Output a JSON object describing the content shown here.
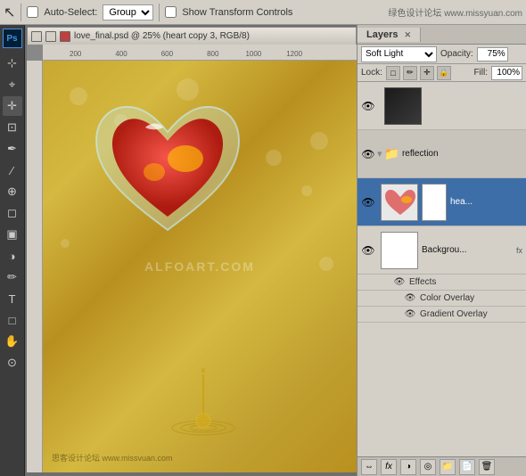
{
  "toolbar": {
    "arrow_tool": "↖",
    "auto_select_label": "Auto-Select:",
    "group_dropdown": "Group",
    "transform_label": "Show Transform Controls",
    "logo_text": "绿色设计论坛 www.missyuan.com"
  },
  "doc_window": {
    "title": "love_final.psd @ 25% (heart copy 3, RGB/8)",
    "ruler_marks_h": [
      "200",
      "400",
      "600",
      "800",
      "1000",
      "1200"
    ],
    "ruler_marks_v": [
      "",
      "",
      "",
      "",
      "",
      "",
      ""
    ],
    "watermark": "ALFOART.COM",
    "watermark2": "思客设计论坛 www.missvuan.com",
    "footer_text": ""
  },
  "layers_panel": {
    "tab_label": "Layers",
    "tab_close": "✕",
    "blend_mode": "Soft Light",
    "opacity_label": "Opacity:",
    "opacity_value": "75%",
    "lock_label": "Lock:",
    "lock_icons": [
      "□",
      "✏",
      "⊕",
      "🔒"
    ],
    "fill_label": "Fill:",
    "fill_value": "100%",
    "layers": [
      {
        "id": "layer-dark",
        "visible": true,
        "name": "",
        "type": "dark",
        "has_folder": false,
        "selected": false
      },
      {
        "id": "layer-reflection",
        "visible": true,
        "name": "reflection",
        "type": "folder",
        "selected": false
      },
      {
        "id": "layer-heart-copy",
        "visible": true,
        "name": "hea...",
        "type": "image",
        "selected": true
      },
      {
        "id": "layer-background",
        "visible": true,
        "name": "Backgrou...",
        "type": "white",
        "fx": true,
        "selected": false
      }
    ],
    "effects_label": "Effects",
    "effect_items": [
      "Color Overlay",
      "Gradient Overlay"
    ],
    "bottom_buttons": [
      "⇔",
      "fx",
      "◑",
      "📄",
      "🗑"
    ]
  }
}
